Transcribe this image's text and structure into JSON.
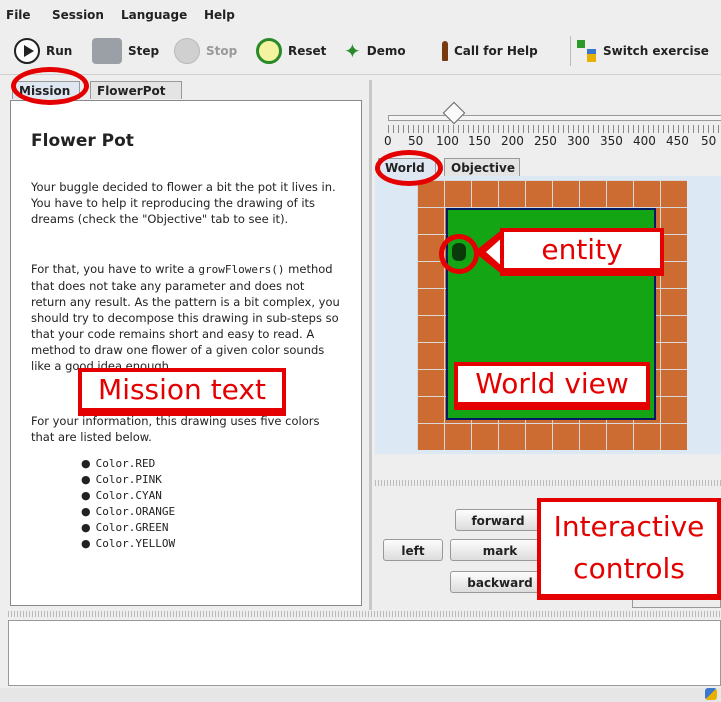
{
  "menu": [
    "File",
    "Session",
    "Language",
    "Help"
  ],
  "toolbar": {
    "run": "Run",
    "step": "Step",
    "stop": "Stop",
    "reset": "Reset",
    "demo": "Demo",
    "help": "Call for Help",
    "switch": "Switch exercise"
  },
  "left_tabs": [
    "Mission",
    "FlowerPot"
  ],
  "mission": {
    "title": "Flower Pot",
    "p1": "Your buggle decided to flower a bit the pot it lives in. You have to help it reproducing the drawing of its dreams (check the \"Objective\" tab to see it).",
    "p2_prefix": "For that, you have to write a ",
    "p2_code": "growFlowers()",
    "p2_suffix": " method that does not take any parameter and does not return any result. As the pattern is a bit complex, you should try to decompose this drawing in sub-steps so that your code remains short and easy to read. A method to draw one flower of a given color sounds like a good idea enough.",
    "p3": "For your information, this drawing uses five colors that are listed below.",
    "colors": [
      "Color.RED",
      "Color.PINK",
      "Color.CYAN",
      "Color.ORANGE",
      "Color.GREEN",
      "Color.YELLOW"
    ]
  },
  "speed_ticks": [
    "0",
    "50",
    "100",
    "150",
    "200",
    "250",
    "300",
    "350",
    "400",
    "450",
    "50"
  ],
  "right_tabs": [
    "World",
    "Objective"
  ],
  "controls": {
    "forward": "forward",
    "left": "left",
    "mark": "mark",
    "backward": "backward"
  },
  "annotations": {
    "entity": "entity",
    "mission_text": "Mission text",
    "world_view": "World view",
    "interactive": "Interactive controls"
  },
  "colors": {
    "accent": "#e40000",
    "soil": "#cc6c33",
    "grass": "#14a514",
    "border": "#001a66"
  }
}
